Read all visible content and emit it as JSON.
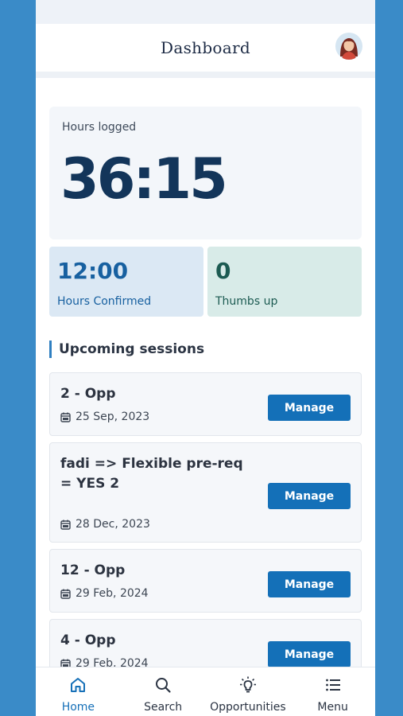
{
  "header": {
    "title": "Dashboard"
  },
  "hours": {
    "label": "Hours logged",
    "value": "36:15"
  },
  "stats": [
    {
      "value": "12:00",
      "label": "Hours Confirmed"
    },
    {
      "value": "0",
      "label": "Thumbs up"
    }
  ],
  "sessions_section": {
    "title": "Upcoming sessions"
  },
  "sessions": [
    {
      "title": "2 - Opp",
      "date": "25 Sep, 2023",
      "button": "Manage"
    },
    {
      "title": "fadi => Flexible pre-req = YES 2",
      "date": "28 Dec, 2023",
      "button": "Manage"
    },
    {
      "title": "12 - Opp",
      "date": "29 Feb, 2024",
      "button": "Manage"
    },
    {
      "title": "4 - Opp",
      "date": "29 Feb, 2024",
      "button": "Manage"
    }
  ],
  "tabs": [
    {
      "label": "Home",
      "icon": "home-icon",
      "active": true
    },
    {
      "label": "Search",
      "icon": "search-icon",
      "active": false
    },
    {
      "label": "Opportunities",
      "icon": "lightbulb-icon",
      "active": false
    },
    {
      "label": "Menu",
      "icon": "menu-icon",
      "active": false
    }
  ],
  "colors": {
    "accent": "#1470b8",
    "frame": "#3a8bc8",
    "hours_value": "#13355a",
    "confirmed_bg": "#dbe8f4",
    "thumbs_bg": "#d8ebe8"
  }
}
